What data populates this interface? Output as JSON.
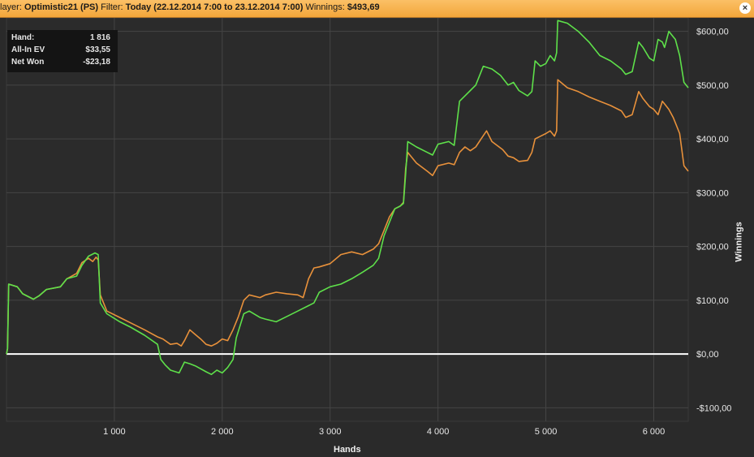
{
  "header": {
    "player_label": "layer:",
    "player_value": "Optimistic21 (PS)",
    "filter_label": "Filter:",
    "filter_value": "Today (22.12.2014 7:00 to 23.12.2014 7:00)",
    "winnings_label": "Winnings:",
    "winnings_value": "$493,69",
    "close_icon": "close-icon"
  },
  "stats": [
    {
      "label": "Hand:",
      "value": "1 816"
    },
    {
      "label": "All-In EV",
      "value": "$33,55"
    },
    {
      "label": "Net Won",
      "value": "-$23,18"
    }
  ],
  "colors": {
    "net_won": "#5ee04a",
    "all_in_ev": "#e8913b",
    "zero_line": "#ffffff",
    "grid": "#454545",
    "header": "#f6b04c"
  },
  "chart_data": {
    "type": "line",
    "xlabel": "Hands",
    "ylabel": "Winnings",
    "xlim": [
      0,
      6320
    ],
    "ylim": [
      -125,
      625
    ],
    "x_ticks": [
      1000,
      2000,
      3000,
      4000,
      5000,
      6000
    ],
    "x_tick_labels": [
      "1 000",
      "2 000",
      "3 000",
      "4 000",
      "5 000",
      "6 000"
    ],
    "y_ticks": [
      -100,
      0,
      100,
      200,
      300,
      400,
      500,
      600
    ],
    "y_tick_labels": [
      "-$100,00",
      "$0,00",
      "$100,00",
      "$200,00",
      "$300,00",
      "$400,00",
      "$500,00",
      "$600,00"
    ],
    "grid": true,
    "series": [
      {
        "color": "#5ee04a",
        "points": [
          [
            0,
            0
          ],
          [
            10,
            10
          ],
          [
            20,
            130
          ],
          [
            100,
            125
          ],
          [
            150,
            112
          ],
          [
            250,
            102
          ],
          [
            300,
            108
          ],
          [
            370,
            120
          ],
          [
            500,
            125
          ],
          [
            560,
            140
          ],
          [
            650,
            145
          ],
          [
            700,
            165
          ],
          [
            760,
            182
          ],
          [
            820,
            188
          ],
          [
            850,
            185
          ],
          [
            870,
            95
          ],
          [
            930,
            75
          ],
          [
            1050,
            60
          ],
          [
            1150,
            50
          ],
          [
            1280,
            35
          ],
          [
            1400,
            18
          ],
          [
            1430,
            -10
          ],
          [
            1470,
            -20
          ],
          [
            1520,
            -30
          ],
          [
            1600,
            -35
          ],
          [
            1650,
            -15
          ],
          [
            1700,
            -18
          ],
          [
            1750,
            -22
          ],
          [
            1850,
            -33
          ],
          [
            1900,
            -38
          ],
          [
            1950,
            -30
          ],
          [
            2000,
            -35
          ],
          [
            2050,
            -25
          ],
          [
            2100,
            -10
          ],
          [
            2130,
            30
          ],
          [
            2200,
            75
          ],
          [
            2250,
            80
          ],
          [
            2350,
            68
          ],
          [
            2400,
            65
          ],
          [
            2500,
            60
          ],
          [
            2600,
            70
          ],
          [
            2700,
            80
          ],
          [
            2800,
            90
          ],
          [
            2850,
            95
          ],
          [
            2900,
            115
          ],
          [
            3000,
            125
          ],
          [
            3100,
            130
          ],
          [
            3200,
            140
          ],
          [
            3300,
            152
          ],
          [
            3400,
            165
          ],
          [
            3450,
            178
          ],
          [
            3500,
            220
          ],
          [
            3550,
            245
          ],
          [
            3600,
            270
          ],
          [
            3650,
            275
          ],
          [
            3680,
            280
          ],
          [
            3700,
            335
          ],
          [
            3720,
            395
          ],
          [
            3800,
            385
          ],
          [
            3900,
            375
          ],
          [
            3950,
            370
          ],
          [
            4000,
            390
          ],
          [
            4100,
            395
          ],
          [
            4150,
            388
          ],
          [
            4200,
            470
          ],
          [
            4250,
            480
          ],
          [
            4300,
            490
          ],
          [
            4350,
            500
          ],
          [
            4420,
            535
          ],
          [
            4500,
            530
          ],
          [
            4580,
            518
          ],
          [
            4650,
            500
          ],
          [
            4700,
            505
          ],
          [
            4750,
            490
          ],
          [
            4830,
            480
          ],
          [
            4870,
            488
          ],
          [
            4900,
            545
          ],
          [
            4950,
            535
          ],
          [
            5000,
            540
          ],
          [
            5040,
            555
          ],
          [
            5080,
            545
          ],
          [
            5100,
            560
          ],
          [
            5110,
            620
          ],
          [
            5200,
            615
          ],
          [
            5300,
            600
          ],
          [
            5400,
            580
          ],
          [
            5500,
            555
          ],
          [
            5600,
            545
          ],
          [
            5700,
            530
          ],
          [
            5740,
            520
          ],
          [
            5800,
            525
          ],
          [
            5860,
            580
          ],
          [
            5900,
            570
          ],
          [
            5960,
            550
          ],
          [
            6000,
            545
          ],
          [
            6040,
            585
          ],
          [
            6080,
            580
          ],
          [
            6100,
            570
          ],
          [
            6140,
            600
          ],
          [
            6180,
            590
          ],
          [
            6200,
            585
          ],
          [
            6240,
            555
          ],
          [
            6280,
            505
          ],
          [
            6320,
            495
          ]
        ]
      },
      {
        "color": "#e8913b",
        "points": [
          [
            0,
            0
          ],
          [
            10,
            10
          ],
          [
            20,
            130
          ],
          [
            100,
            125
          ],
          [
            150,
            112
          ],
          [
            250,
            102
          ],
          [
            300,
            108
          ],
          [
            370,
            120
          ],
          [
            500,
            125
          ],
          [
            560,
            140
          ],
          [
            650,
            150
          ],
          [
            700,
            170
          ],
          [
            760,
            178
          ],
          [
            800,
            172
          ],
          [
            830,
            180
          ],
          [
            850,
            175
          ],
          [
            870,
            110
          ],
          [
            930,
            80
          ],
          [
            1050,
            68
          ],
          [
            1150,
            58
          ],
          [
            1280,
            45
          ],
          [
            1400,
            32
          ],
          [
            1450,
            28
          ],
          [
            1520,
            18
          ],
          [
            1580,
            20
          ],
          [
            1620,
            15
          ],
          [
            1650,
            25
          ],
          [
            1700,
            45
          ],
          [
            1740,
            38
          ],
          [
            1800,
            28
          ],
          [
            1850,
            18
          ],
          [
            1900,
            15
          ],
          [
            1950,
            20
          ],
          [
            2000,
            28
          ],
          [
            2050,
            25
          ],
          [
            2100,
            45
          ],
          [
            2150,
            70
          ],
          [
            2200,
            100
          ],
          [
            2250,
            110
          ],
          [
            2350,
            105
          ],
          [
            2400,
            110
          ],
          [
            2500,
            115
          ],
          [
            2600,
            112
          ],
          [
            2700,
            110
          ],
          [
            2750,
            105
          ],
          [
            2800,
            140
          ],
          [
            2850,
            160
          ],
          [
            2900,
            162
          ],
          [
            3000,
            168
          ],
          [
            3100,
            185
          ],
          [
            3200,
            190
          ],
          [
            3300,
            185
          ],
          [
            3400,
            195
          ],
          [
            3450,
            205
          ],
          [
            3500,
            230
          ],
          [
            3550,
            255
          ],
          [
            3600,
            270
          ],
          [
            3650,
            275
          ],
          [
            3680,
            282
          ],
          [
            3700,
            345
          ],
          [
            3720,
            375
          ],
          [
            3800,
            355
          ],
          [
            3900,
            340
          ],
          [
            3950,
            332
          ],
          [
            4000,
            350
          ],
          [
            4100,
            355
          ],
          [
            4150,
            352
          ],
          [
            4200,
            375
          ],
          [
            4250,
            385
          ],
          [
            4300,
            378
          ],
          [
            4350,
            385
          ],
          [
            4400,
            400
          ],
          [
            4450,
            415
          ],
          [
            4500,
            395
          ],
          [
            4600,
            380
          ],
          [
            4650,
            368
          ],
          [
            4700,
            365
          ],
          [
            4750,
            358
          ],
          [
            4830,
            360
          ],
          [
            4870,
            375
          ],
          [
            4900,
            400
          ],
          [
            4950,
            405
          ],
          [
            5000,
            410
          ],
          [
            5040,
            415
          ],
          [
            5080,
            405
          ],
          [
            5100,
            415
          ],
          [
            5110,
            510
          ],
          [
            5200,
            495
          ],
          [
            5300,
            488
          ],
          [
            5400,
            478
          ],
          [
            5500,
            470
          ],
          [
            5600,
            462
          ],
          [
            5700,
            452
          ],
          [
            5740,
            440
          ],
          [
            5800,
            445
          ],
          [
            5860,
            488
          ],
          [
            5900,
            475
          ],
          [
            5960,
            460
          ],
          [
            6000,
            455
          ],
          [
            6040,
            445
          ],
          [
            6080,
            470
          ],
          [
            6100,
            465
          ],
          [
            6140,
            455
          ],
          [
            6180,
            440
          ],
          [
            6200,
            430
          ],
          [
            6240,
            410
          ],
          [
            6280,
            350
          ],
          [
            6320,
            340
          ]
        ]
      }
    ]
  }
}
